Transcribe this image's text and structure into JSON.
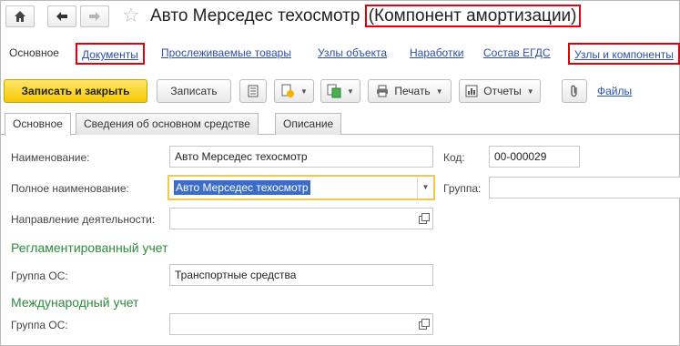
{
  "window": {
    "title_main": "Авто Мерседес техосмотр",
    "title_suffix": "(Компонент амортизации)"
  },
  "panel_links": [
    {
      "label": "Основное"
    },
    {
      "label": "Документы"
    },
    {
      "label": "Прослеживаемые товары"
    },
    {
      "label": "Узлы объекта"
    },
    {
      "label": "Наработки"
    },
    {
      "label": "Состав ЕГДС"
    },
    {
      "label": "Узлы и компоненты"
    }
  ],
  "toolbar": {
    "save_close_label": "Записать и закрыть",
    "save_label": "Записать",
    "print_label": "Печать",
    "reports_label": "Отчеты",
    "files_label": "Файлы"
  },
  "tabs": [
    {
      "label": "Основное"
    },
    {
      "label": "Сведения об основном средстве"
    },
    {
      "label": "Описание"
    }
  ],
  "form": {
    "name_label": "Наименование:",
    "name_value": "Авто Мерседес техосмотр",
    "code_label": "Код:",
    "code_value": "00-000029",
    "full_name_label": "Полное наименование:",
    "full_name_value": "Авто Мерседес техосмотр",
    "group_label": "Группа:",
    "group_value": "",
    "direction_label": "Направление деятельности:",
    "direction_value": "",
    "section_regulated": "Регламентированный учет",
    "os_group_label": "Группа ОС:",
    "os_group_value": "Транспортные средства",
    "section_international": "Международный учет",
    "intl_os_group_label": "Группа ОС:",
    "intl_os_group_value": ""
  },
  "colors": {
    "accent_red": "#e0000e",
    "link_blue": "#2b4fa8",
    "section_green": "#2e8b3a",
    "primary_yellow": "#f5c800"
  }
}
